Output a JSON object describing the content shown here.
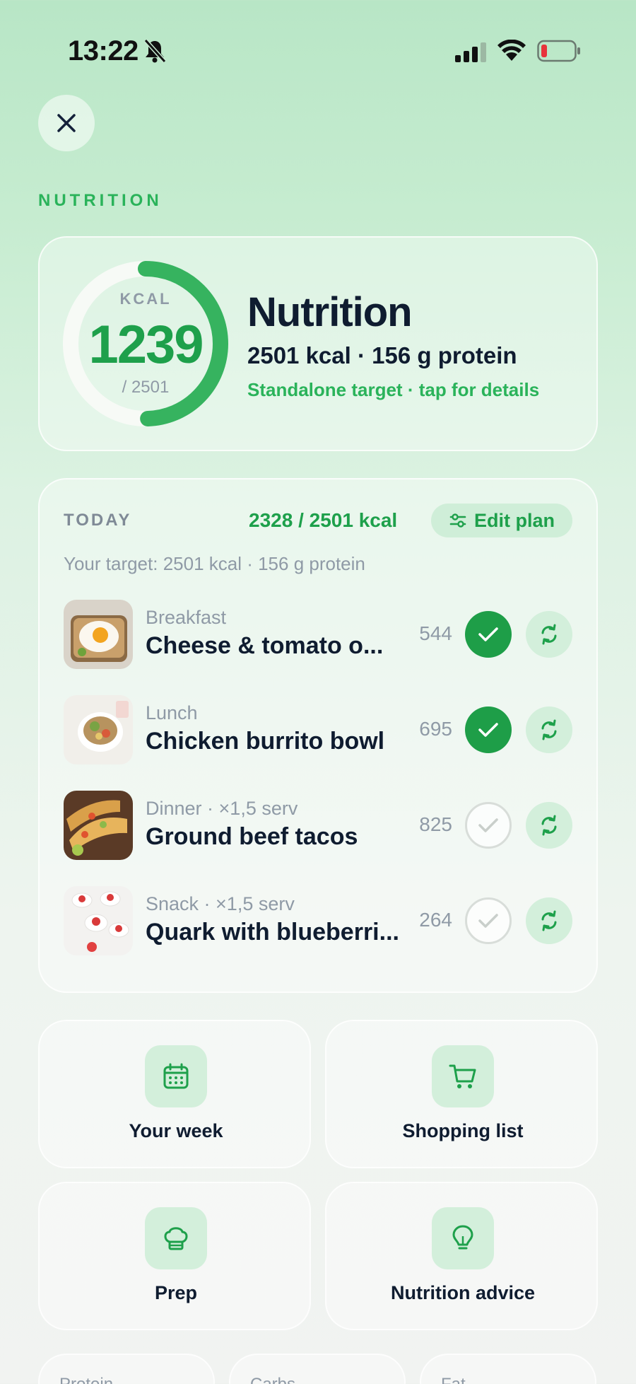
{
  "status_bar": {
    "time": "13:22"
  },
  "header": {
    "section_label": "NUTRITION"
  },
  "summary": {
    "kcal_label": "KCAL",
    "kcal_consumed": "1239",
    "kcal_target": "/ 2501",
    "progress_fraction": 0.495,
    "title": "Nutrition",
    "subtitle": "2501 kcal · 156 g protein",
    "link": "Standalone target · tap for details"
  },
  "today": {
    "label": "TODAY",
    "kcal_total": "2328 / 2501 kcal",
    "edit_label": "Edit plan",
    "target_line": "Your target: 2501 kcal · 156 g protein",
    "meals": [
      {
        "type": "Breakfast",
        "name": "Cheese & tomato o...",
        "kcal": "544",
        "done": true
      },
      {
        "type": "Lunch",
        "name": "Chicken burrito bowl",
        "kcal": "695",
        "done": true
      },
      {
        "type": "Dinner  ·  ×1,5 serv",
        "name": "Ground beef tacos",
        "kcal": "825",
        "done": false
      },
      {
        "type": "Snack  ·  ×1,5 serv",
        "name": "Quark with blueberri...",
        "kcal": "264",
        "done": false
      }
    ]
  },
  "tiles": [
    {
      "label": "Your week",
      "icon": "calendar-icon"
    },
    {
      "label": "Shopping list",
      "icon": "cart-icon"
    },
    {
      "label": "Prep",
      "icon": "chef-hat-icon"
    },
    {
      "label": "Nutrition advice",
      "icon": "lightbulb-icon"
    }
  ],
  "macros": [
    {
      "label": "Protein"
    },
    {
      "label": "Carbs"
    },
    {
      "label": "Fat"
    }
  ],
  "colors": {
    "accent": "#1ea04b",
    "accent_light": "#d3efdb",
    "text_dark": "#0f1c30",
    "muted": "#8f9aa6"
  }
}
